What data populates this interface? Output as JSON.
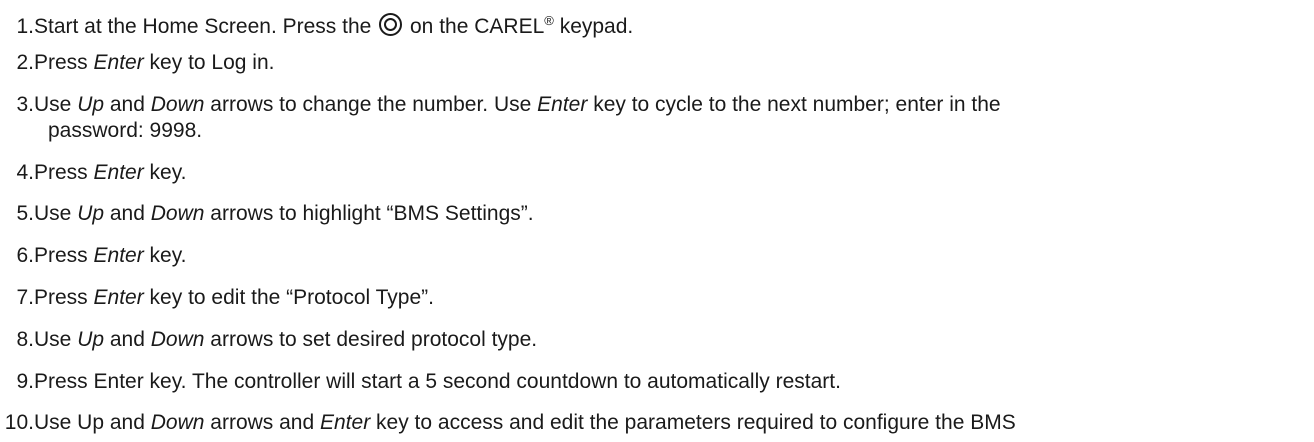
{
  "steps": [
    {
      "num": "1.",
      "a": "Start at the Home Screen. Press the ",
      "icon": "program-key-icon",
      "b": " on the CAREL",
      "reg": "®",
      "c": " keypad."
    },
    {
      "num": "2.",
      "a": "Press ",
      "e1": "Enter",
      "b": " key to Log in."
    },
    {
      "num": "3.",
      "a": "Use ",
      "e1": "Up",
      "b": " and ",
      "e2": "Down",
      "c": " arrows to change the number. Use ",
      "e3": "Enter",
      "d": " key to cycle to the next number; enter in the",
      "line2": "password: 9998."
    },
    {
      "num": "4.",
      "a": "Press ",
      "e1": "Enter",
      "b": " key."
    },
    {
      "num": "5.",
      "a": "Use ",
      "e1": "Up",
      "b": " and ",
      "e2": "Down",
      "c": " arrows to highlight “BMS Settings”."
    },
    {
      "num": "6.",
      "a": "Press ",
      "e1": "Enter",
      "b": " key."
    },
    {
      "num": "7.",
      "a": "Press ",
      "e1": "Enter",
      "b": " key to edit the “Protocol Type”."
    },
    {
      "num": "8.",
      "a": "Use ",
      "e1": "Up",
      "b": " and ",
      "e2": "Down",
      "c": " arrows to set desired protocol type."
    },
    {
      "num": "9.",
      "a": "Press Enter key. The controller will start a 5 second countdown to automatically restart."
    },
    {
      "num": "10.",
      "a": "Use Up and ",
      "e1": "Down",
      "b": " arrows and ",
      "e2": "Enter",
      "c": " key to access and edit the parameters required to configure the BMS"
    }
  ]
}
